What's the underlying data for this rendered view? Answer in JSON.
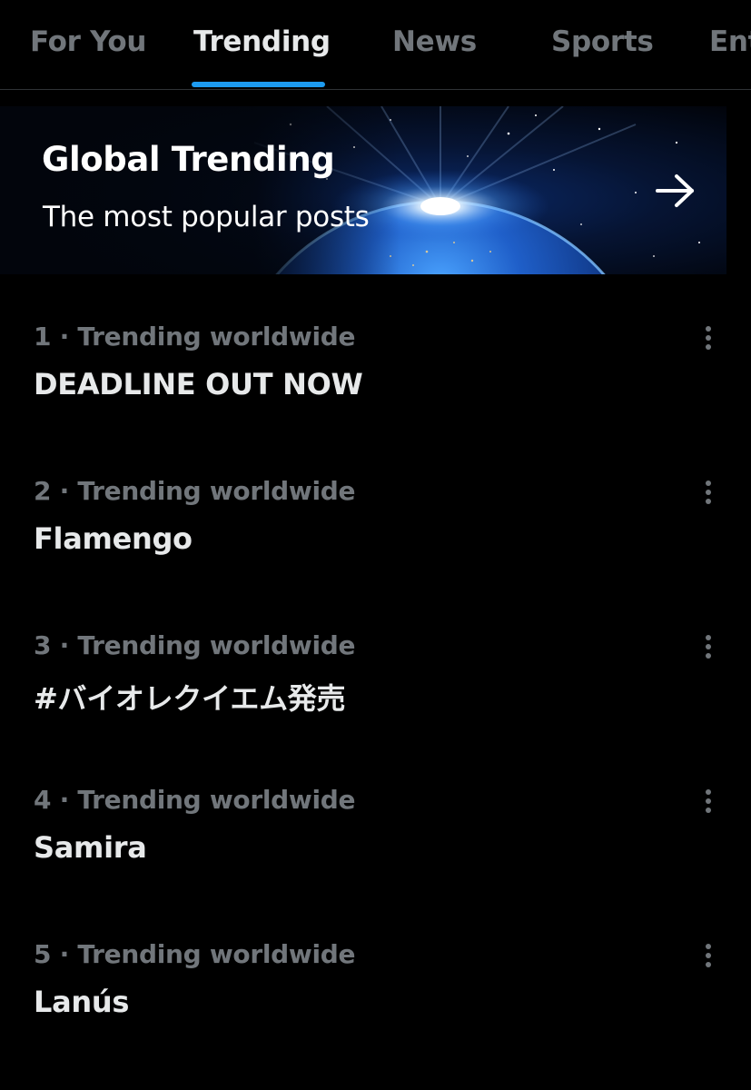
{
  "tabs": [
    {
      "label": "For You",
      "active": false
    },
    {
      "label": "Trending",
      "active": true
    },
    {
      "label": "News",
      "active": false
    },
    {
      "label": "Sports",
      "active": false
    },
    {
      "label": "Ent",
      "active": false
    }
  ],
  "banner": {
    "title": "Global Trending",
    "subtitle": "The most popular posts",
    "arrow_icon": "arrow-right-icon"
  },
  "trends": [
    {
      "meta": "1 · Trending worldwide",
      "name": "DEADLINE OUT NOW"
    },
    {
      "meta": "2 · Trending worldwide",
      "name": "Flamengo"
    },
    {
      "meta": "3 · Trending worldwide",
      "name": "#バイオレクイエム発売"
    },
    {
      "meta": "4 · Trending worldwide",
      "name": "Samira"
    },
    {
      "meta": "5 · Trending worldwide",
      "name": "Lanús"
    }
  ],
  "colors": {
    "background": "#000000",
    "accent": "#1d9bf0",
    "primary_text": "#e7e9ea",
    "secondary_text": "#71767b",
    "divider": "#2f3336"
  }
}
